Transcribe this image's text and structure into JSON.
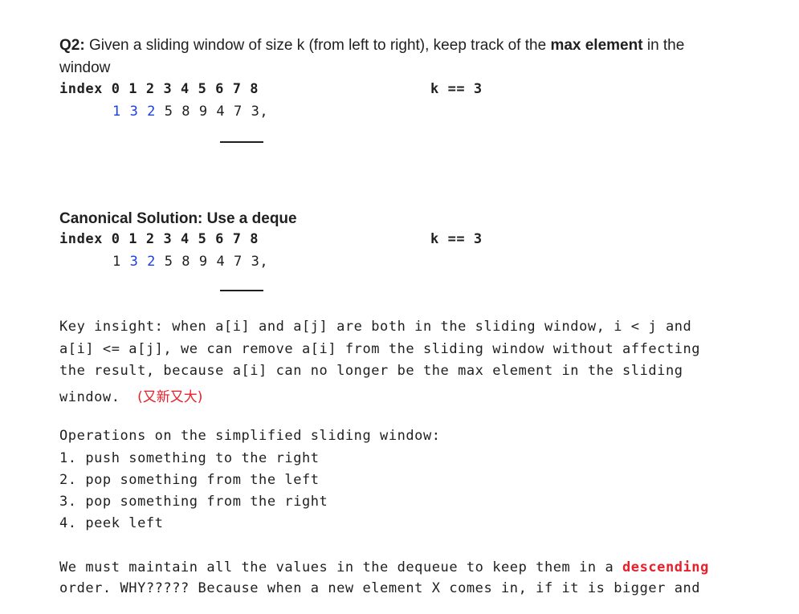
{
  "q2": {
    "label": "Q2:",
    "text_before": " Given a sliding window of size k (from left to right), keep track of the ",
    "bold_phrase": "max element",
    "text_after": " in the",
    "line2": "window"
  },
  "index_block_1": {
    "index_label": "index",
    "indices": "0 1 2 3 4 5 6 7 8",
    "k_text": "k == 3",
    "values_highlight": "1 3 2",
    "values_rest": " 5 8 9 4 7 3,",
    "underline": "_____"
  },
  "canonical": {
    "heading": "Canonical Solution: Use a deque"
  },
  "index_block_2": {
    "index_label": "index",
    "indices": "0 1 2 3 4 5 6 7 8",
    "k_text": "k == 3",
    "value_first": "1",
    "values_highlight": "3 2",
    "values_rest": " 5 8 9 4 7 3,",
    "underline": "_____"
  },
  "insight": {
    "line1": "Key insight: when a[i] and a[j] are both in the sliding window, i < j and",
    "line2": "a[i] <= a[j], we can remove a[i] from the sliding window without affecting",
    "line3": "the result, because a[i] can no longer be the max element in the sliding",
    "line4": "window.",
    "chinese_note": "(又新又大)"
  },
  "operations": {
    "title": "Operations on the simplified sliding window:",
    "items": [
      "1. push something to the right",
      "2. pop something from the left",
      "3. pop something from the right",
      "4. peek left"
    ]
  },
  "maintain": {
    "line1_before": "We must maintain all the values in the dequeue to keep them in a ",
    "line1_highlight": "descending",
    "line2": "order. WHY????? Because when a new element X comes in, if it is bigger and"
  }
}
